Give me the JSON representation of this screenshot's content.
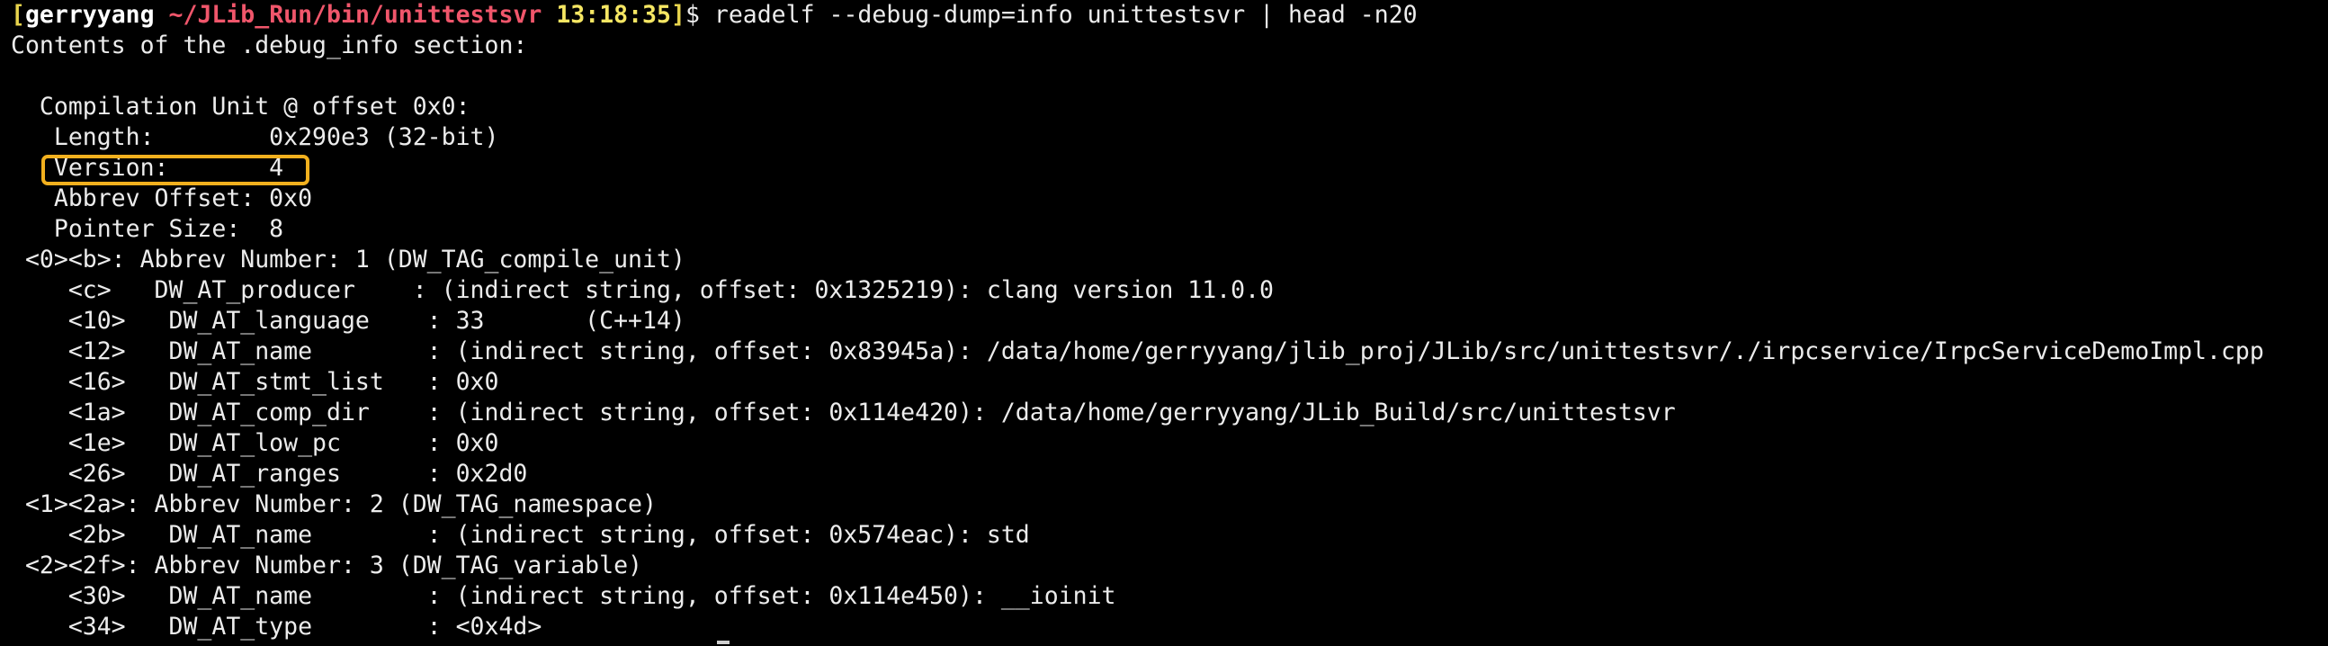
{
  "prompt": {
    "open_bracket": "[",
    "user": "gerryyang",
    "path": "~/JLib_Run/bin/unittestsvr",
    "time": "13:18:35",
    "close_bracket": "]",
    "dollar": "$",
    "command": " readelf --debug-dump=info unittestsvr | head -n20"
  },
  "output": [
    "Contents of the .debug_info section:",
    "",
    "  Compilation Unit @ offset 0x0:",
    "   Length:        0x290e3 (32-bit)",
    "   Version:       4",
    "   Abbrev Offset: 0x0",
    "   Pointer Size:  8",
    " <0><b>: Abbrev Number: 1 (DW_TAG_compile_unit)",
    "    <c>   DW_AT_producer    : (indirect string, offset: 0x1325219): clang version 11.0.0",
    "    <10>   DW_AT_language    : 33       (C++14)",
    "    <12>   DW_AT_name        : (indirect string, offset: 0x83945a): /data/home/gerryyang/jlib_proj/JLib/src/unittestsvr/./irpcservice/IrpcServiceDemoImpl.cpp",
    "    <16>   DW_AT_stmt_list   : 0x0",
    "    <1a>   DW_AT_comp_dir    : (indirect string, offset: 0x114e420): /data/home/gerryyang/JLib_Build/src/unittestsvr",
    "    <1e>   DW_AT_low_pc      : 0x0",
    "    <26>   DW_AT_ranges      : 0x2d0",
    " <1><2a>: Abbrev Number: 2 (DW_TAG_namespace)",
    "    <2b>   DW_AT_name        : (indirect string, offset: 0x574eac): std",
    " <2><2f>: Abbrev Number: 3 (DW_TAG_variable)",
    "    <30>   DW_AT_name        : (indirect string, offset: 0x114e450): __ioinit",
    "    <34>   DW_AT_type        : <0x4d>"
  ],
  "highlight": {
    "color": "#f2b01e",
    "target_line": "   Version:       4"
  },
  "colors": {
    "background": "#000000",
    "text": "#ececec",
    "user": "#ffffff",
    "path": "#f0566b",
    "time": "#f5e663"
  }
}
